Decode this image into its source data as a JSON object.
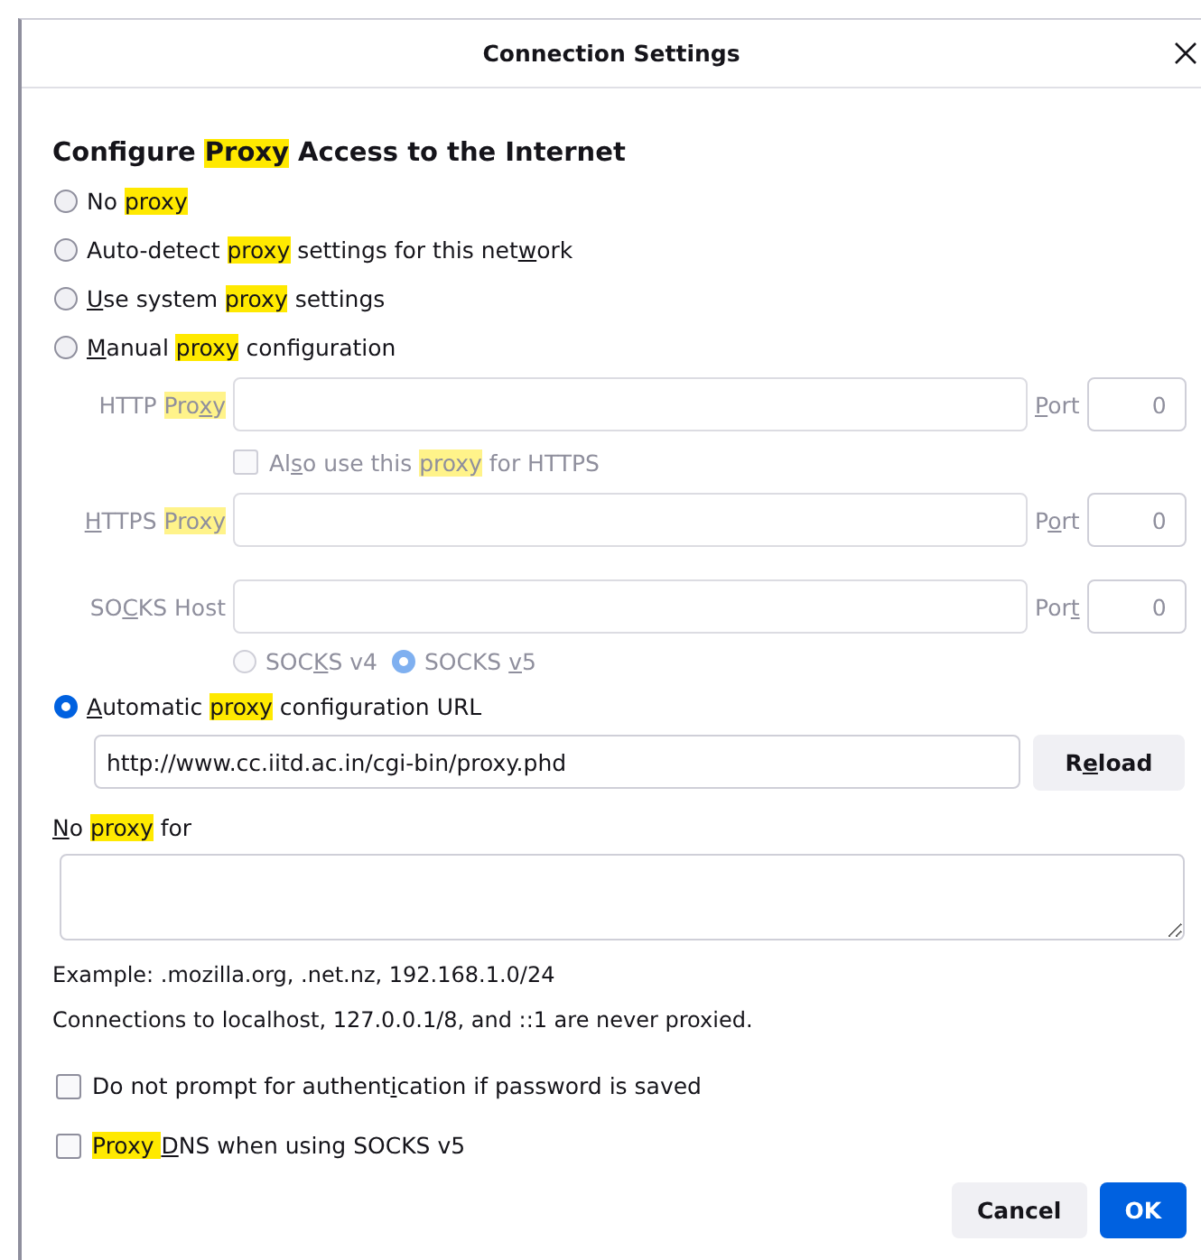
{
  "window": {
    "title": "Connection Settings"
  },
  "heading": [
    {
      "kind": "plain",
      "text": "Configure "
    },
    {
      "kind": "highlight",
      "text": "Proxy"
    },
    {
      "kind": "plain",
      "text": " Access to the Internet"
    }
  ],
  "proxy_modes": [
    {
      "selected": false,
      "label": [
        {
          "kind": "plain",
          "text": "No "
        },
        {
          "kind": "highlight",
          "text": "proxy"
        }
      ]
    },
    {
      "selected": false,
      "label": [
        {
          "kind": "plain",
          "text": "Auto-detect "
        },
        {
          "kind": "highlight",
          "text": "proxy"
        },
        {
          "kind": "plain",
          "text": " settings for this net"
        },
        {
          "kind": "key",
          "text": "w"
        },
        {
          "kind": "plain",
          "text": "ork"
        }
      ]
    },
    {
      "selected": false,
      "label": [
        {
          "kind": "key",
          "text": "U"
        },
        {
          "kind": "plain",
          "text": "se system "
        },
        {
          "kind": "highlight",
          "text": "proxy"
        },
        {
          "kind": "plain",
          "text": " settings"
        }
      ]
    },
    {
      "selected": false,
      "label": [
        {
          "kind": "key",
          "text": "M"
        },
        {
          "kind": "plain",
          "text": "anual "
        },
        {
          "kind": "highlight",
          "text": "proxy"
        },
        {
          "kind": "plain",
          "text": " configuration"
        }
      ]
    }
  ],
  "manual": {
    "disabled": true,
    "rows": [
      {
        "kind": "host",
        "label": [
          {
            "kind": "plain",
            "text": "HTTP "
          },
          {
            "kind": "highlight",
            "text": "Pro"
          },
          {
            "kind": "highlight-key",
            "text": "x"
          },
          {
            "kind": "highlight",
            "text": "y"
          }
        ],
        "port_label": [
          {
            "kind": "key",
            "text": "P"
          },
          {
            "kind": "plain",
            "text": "ort"
          }
        ],
        "port": "0"
      },
      {
        "kind": "checkbox",
        "checked": false,
        "label": [
          {
            "kind": "plain",
            "text": "Al"
          },
          {
            "kind": "key",
            "text": "s"
          },
          {
            "kind": "plain",
            "text": "o use this "
          },
          {
            "kind": "highlight",
            "text": "proxy"
          },
          {
            "kind": "plain",
            "text": " for HTTPS"
          }
        ]
      },
      {
        "kind": "host",
        "label": [
          {
            "kind": "key",
            "text": "H"
          },
          {
            "kind": "plain",
            "text": "TTPS "
          },
          {
            "kind": "highlight",
            "text": "Proxy"
          }
        ],
        "port_label": [
          {
            "kind": "plain",
            "text": "P"
          },
          {
            "kind": "key",
            "text": "o"
          },
          {
            "kind": "plain",
            "text": "rt"
          }
        ],
        "port": "0"
      },
      {
        "kind": "host",
        "label": [
          {
            "kind": "plain",
            "text": "SO"
          },
          {
            "kind": "key",
            "text": "C"
          },
          {
            "kind": "plain",
            "text": "KS Host"
          }
        ],
        "port_label": [
          {
            "kind": "plain",
            "text": "Por"
          },
          {
            "kind": "key",
            "text": "t"
          }
        ],
        "port": "0"
      },
      {
        "kind": "radios",
        "options": [
          {
            "selected": false,
            "label": [
              {
                "kind": "plain",
                "text": "SOC"
              },
              {
                "kind": "key",
                "text": "K"
              },
              {
                "kind": "plain",
                "text": "S v4"
              }
            ]
          },
          {
            "selected": true,
            "label": [
              {
                "kind": "plain",
                "text": "SOCKS "
              },
              {
                "kind": "key",
                "text": "v"
              },
              {
                "kind": "plain",
                "text": "5"
              }
            ]
          }
        ]
      }
    ]
  },
  "auto": {
    "selected": true,
    "label": [
      {
        "kind": "key",
        "text": "A"
      },
      {
        "kind": "plain",
        "text": "utomatic "
      },
      {
        "kind": "highlight",
        "text": "proxy"
      },
      {
        "kind": "plain",
        "text": " configuration URL"
      }
    ],
    "url": "http://www.cc.iitd.ac.in/cgi-bin/proxy.phd",
    "reload": [
      {
        "kind": "plain",
        "text": "R"
      },
      {
        "kind": "key",
        "text": "e"
      },
      {
        "kind": "plain",
        "text": "load"
      }
    ]
  },
  "no_proxy": {
    "label": [
      {
        "kind": "key",
        "text": "N"
      },
      {
        "kind": "plain",
        "text": "o "
      },
      {
        "kind": "highlight",
        "text": "proxy"
      },
      {
        "kind": "plain",
        "text": " for"
      }
    ]
  },
  "notes": [
    "Example: .mozilla.org, .net.nz, 192.168.1.0/24",
    "Connections to localhost, 127.0.0.1/8, and ::1 are never proxied."
  ],
  "options": [
    {
      "checked": false,
      "label": [
        {
          "kind": "plain",
          "text": "Do not prompt for authent"
        },
        {
          "kind": "key",
          "text": "i"
        },
        {
          "kind": "plain",
          "text": "cation if password is saved"
        }
      ]
    },
    {
      "checked": false,
      "label": [
        {
          "kind": "highlight",
          "text": "Proxy "
        },
        {
          "kind": "key",
          "text": "D"
        },
        {
          "kind": "plain",
          "text": "NS when using SOCKS v5"
        }
      ]
    }
  ],
  "buttons": [
    {
      "kind": "secondary",
      "label": "Cancel"
    },
    {
      "kind": "primary",
      "label": "OK"
    }
  ]
}
